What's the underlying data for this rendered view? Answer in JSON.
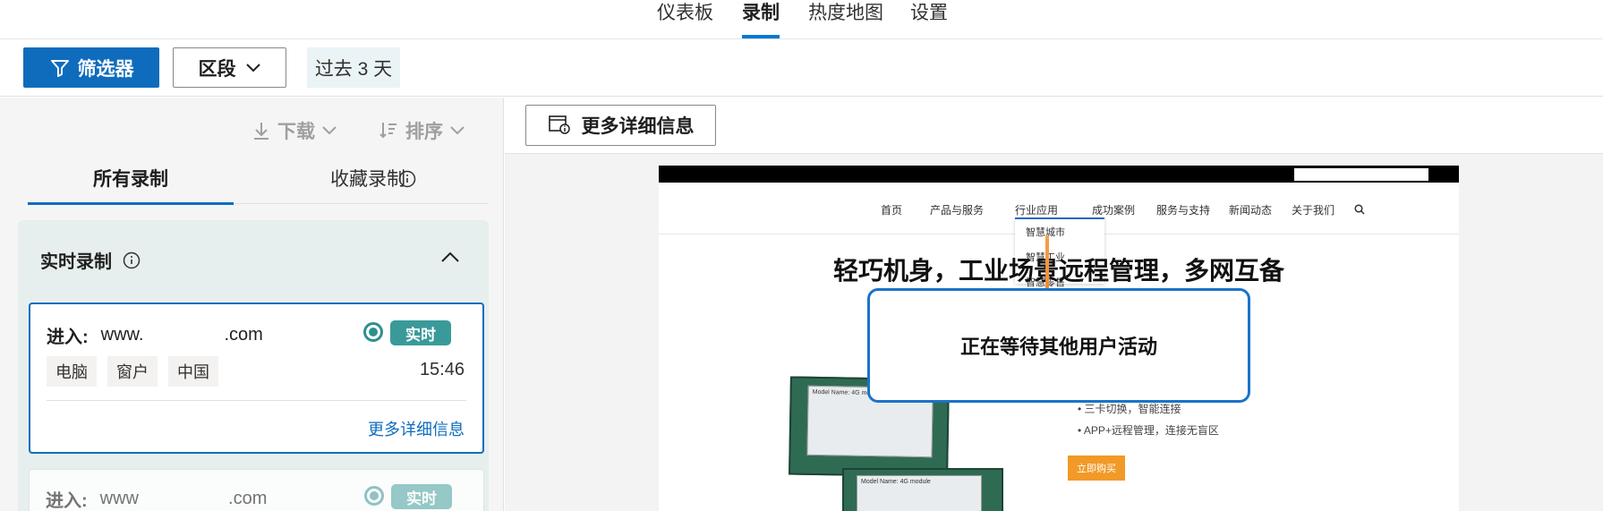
{
  "topnav": {
    "tabs": [
      {
        "label": "仪表板",
        "active": false
      },
      {
        "label": "录制",
        "active": true
      },
      {
        "label": "热度地图",
        "active": false
      },
      {
        "label": "设置",
        "active": false
      }
    ]
  },
  "toolbar": {
    "filter_label": "筛选器",
    "segment_label": "区段",
    "time_range": "过去 3 天"
  },
  "left": {
    "download_label": "下载",
    "sort_label": "排序",
    "tabs": {
      "all": "所有录制",
      "favorites": "收藏录制"
    },
    "realtime": {
      "title": "实时录制",
      "cards": [
        {
          "entry_label": "进入:",
          "url_prefix": "www.",
          "url_suffix": ".com",
          "badge": "实时",
          "tags": [
            "电脑",
            "窗户",
            "中国"
          ],
          "time": "15:46",
          "more": "更多详细信息"
        },
        {
          "entry_label": "进入:",
          "url_prefix": "www",
          "url_suffix": ".com",
          "badge": "实时"
        }
      ]
    }
  },
  "right": {
    "details_button": "更多详细信息",
    "preview": {
      "nav": [
        "首页",
        "产品与服务",
        "行业应用",
        "成功案例",
        "服务与支持",
        "新闻动态",
        "关于我们"
      ],
      "dropdown": [
        "智慧城市",
        "智慧工业",
        "智慧零售"
      ],
      "headline": "轻巧机身，工业场景远程管理，多网互备",
      "modal": "正在等待其他用户活动",
      "bullets": [
        "三卡切换，智能连接",
        "APP+远程管理，连接无盲区"
      ],
      "buy": "立即购买",
      "module_label": "Model Name: 4G module"
    }
  },
  "colors": {
    "accent": "#0f6cbd",
    "live": "#3a9a99",
    "modal_border": "#1a73c9"
  }
}
